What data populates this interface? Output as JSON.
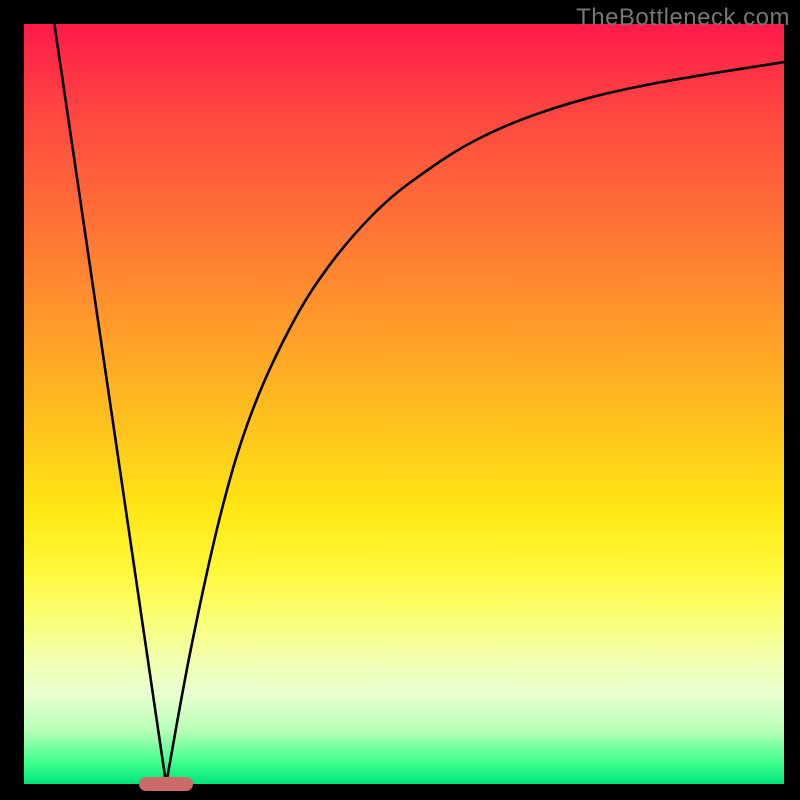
{
  "watermark": "TheBottleneck.com",
  "chart_data": {
    "type": "line",
    "title": "",
    "xlabel": "",
    "ylabel": "",
    "xlim": [
      0,
      100
    ],
    "ylim": [
      0,
      100
    ],
    "grid": false,
    "legend": false,
    "series": [
      {
        "name": "left-line",
        "x": [
          4,
          18.7
        ],
        "y": [
          100,
          0
        ]
      },
      {
        "name": "right-curve",
        "x": [
          18.7,
          22,
          26,
          30,
          35,
          40,
          46,
          52,
          60,
          70,
          82,
          100
        ],
        "y": [
          0,
          18,
          36,
          49,
          60,
          68,
          75,
          80,
          85,
          89,
          92,
          95
        ]
      }
    ],
    "minimum_marker_x": 18.7,
    "background_gradient": {
      "top": "#ff1a4a",
      "bottom": "#00e47a"
    }
  }
}
